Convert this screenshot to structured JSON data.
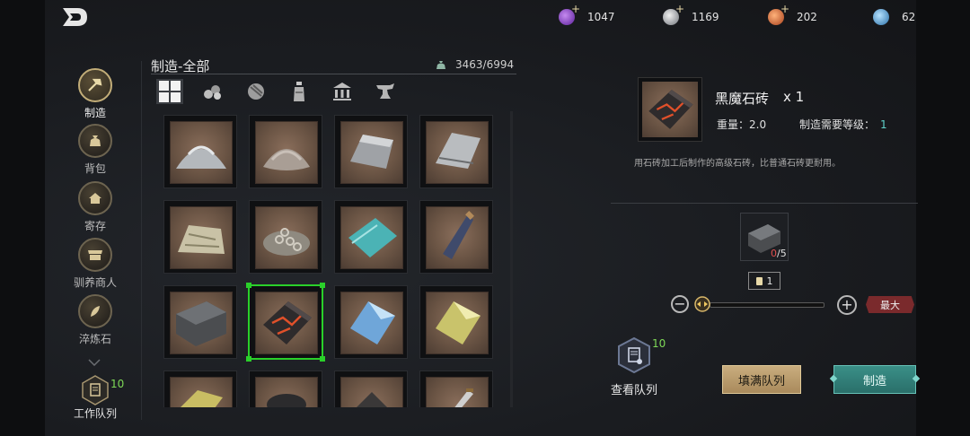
{
  "currencies": [
    {
      "name": "purple-gem-icon",
      "value": "1047",
      "color": "#8a3fd1"
    },
    {
      "name": "silver-coin-icon",
      "value": "1169",
      "color": "#b8bcc4"
    },
    {
      "name": "orange-token-icon",
      "value": "202",
      "color": "#d9683a"
    },
    {
      "name": "blue-crystal-icon",
      "value": "62",
      "color": "#4a9fd6"
    }
  ],
  "sidebar": {
    "items": [
      {
        "label": "制造",
        "icon": "hammer-icon"
      },
      {
        "label": "背包",
        "icon": "bag-icon"
      },
      {
        "label": "寄存",
        "icon": "house-icon"
      },
      {
        "label": "驯养商人",
        "icon": "stall-icon"
      },
      {
        "label": "淬炼石",
        "icon": "feather-icon"
      }
    ],
    "queue": {
      "label": "工作队列",
      "count": "10"
    }
  },
  "panel": {
    "title": "制造-全部",
    "capacity": "3463/6994",
    "categories": [
      "grid-icon",
      "logs-icon",
      "ore-icon",
      "potion-icon",
      "temple-icon",
      "anvil-icon"
    ]
  },
  "items": [
    "salt-pile",
    "powder-pile",
    "silver-ingot",
    "metal-sheet",
    "cloth-pile",
    "chain-pile",
    "teal-plates",
    "dark-vial",
    "iron-brick",
    "black-magic-brick",
    "blue-crystal",
    "yellow-crystal",
    "gold-bar",
    "coal-pile",
    "dark-ore",
    "dagger"
  ],
  "selected_index": 9,
  "detail": {
    "name": "黑魔石砖",
    "qty": "x 1",
    "weight": "重量：2.0",
    "level_label": "制造需要等级：",
    "level_value": "1",
    "description": "用石砖加工后制作的高级石砖，比普通石砖更耐用。",
    "material_have": "0",
    "material_need": "/5",
    "quantity": "1",
    "max_label": "最大",
    "queue_label": "查看队列",
    "queue_count": "10",
    "fill_label": "填满队列",
    "craft_label": "制造",
    "slider_fraction": 0
  }
}
